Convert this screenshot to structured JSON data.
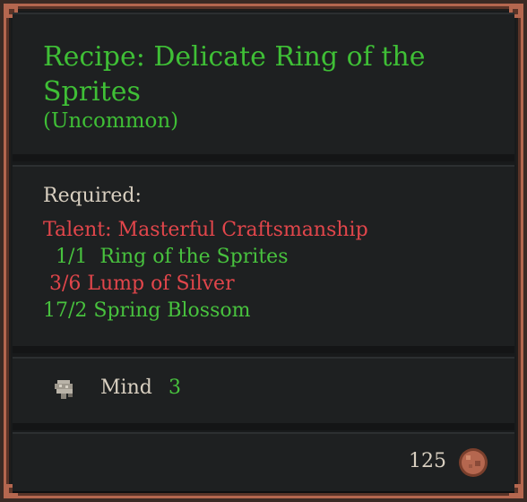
{
  "tooltip": {
    "title": "Recipe: Delicate Ring of the Sprites",
    "rarity": "(Uncommon)",
    "required_label": "Required:",
    "requirements": [
      {
        "text": "Talent: Masterful Craftsmanship",
        "status": "unmet"
      },
      {
        "text": "  1/1  Ring of the Sprites",
        "status": "met"
      },
      {
        "text": " 3/6 Lump of Silver",
        "status": "unmet"
      },
      {
        "text": "17/2 Spring Blossom",
        "status": "met"
      }
    ],
    "stat": {
      "icon": "mind-brain-icon",
      "name": "Mind",
      "value": "3"
    },
    "price": "125",
    "currency_icon": "copper-coin-icon"
  },
  "colors": {
    "title_green": "#3fbf36",
    "met_green": "#48c23e",
    "unmet_red": "#e2464b",
    "text_light": "#d8cfc0",
    "frame_copper": "#b5674f"
  }
}
